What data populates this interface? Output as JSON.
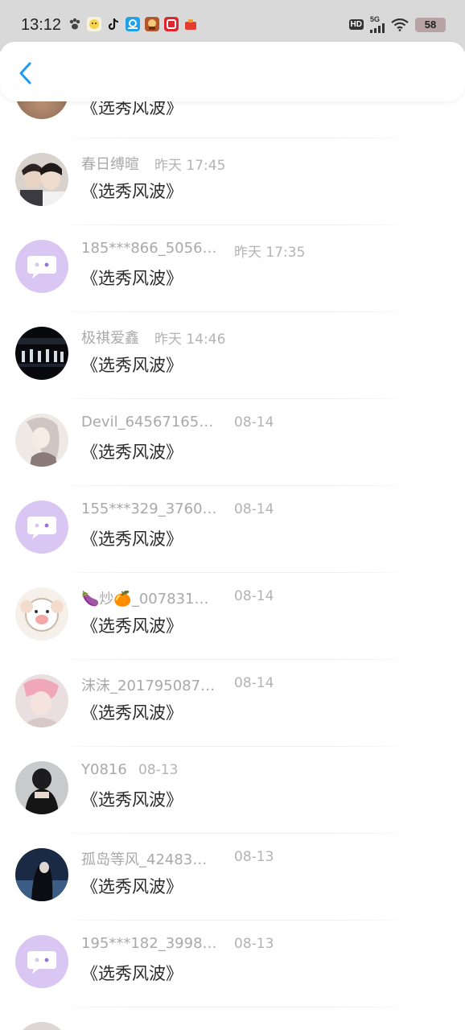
{
  "status_bar": {
    "time": "13:12",
    "network": "5G",
    "hd": "HD",
    "battery": "58",
    "app_icons": [
      "paw-icon",
      "emoji-icon",
      "tiktok-icon",
      "app-blue-icon",
      "game-icon",
      "red-app-icon",
      "red-box-icon"
    ]
  },
  "header": {
    "back_icon": "chevron-left-icon",
    "accent_color": "#1e9bf0"
  },
  "messages": [
    {
      "name": "",
      "time": "",
      "text": "《选秀风波》",
      "avatar": "photo-brown"
    },
    {
      "name": "春日缚暄",
      "time": "昨天 17:45",
      "text": "《选秀风波》",
      "avatar": "photo-boys"
    },
    {
      "name": "185***866_5056…",
      "time": "昨天 17:35",
      "text": "《选秀风波》",
      "avatar": "default"
    },
    {
      "name": "极祺爱鑫",
      "time": "昨天 14:46",
      "text": "《选秀风波》",
      "avatar": "photo-stage"
    },
    {
      "name": "Devil_64567165…",
      "time": "08-14",
      "text": "《选秀风波》",
      "avatar": "photo-anime"
    },
    {
      "name": "155***329_3760…",
      "time": "08-14",
      "text": "《选秀风波》",
      "avatar": "default"
    },
    {
      "name": "🍆炒🍊_007831…",
      "time": "08-14",
      "text": "《选秀风波》",
      "avatar": "photo-cartoon"
    },
    {
      "name": "沫沫_201795087…",
      "time": "08-14",
      "text": "《选秀风波》",
      "avatar": "photo-pink"
    },
    {
      "name": "Y0816",
      "time": "08-13",
      "text": "《选秀风波》",
      "avatar": "photo-dark"
    },
    {
      "name": "孤岛等风_42483…",
      "time": "08-13",
      "text": "《选秀风波》",
      "avatar": "photo-sea"
    },
    {
      "name": "195***182_3998…",
      "time": "08-13",
      "text": "《选秀风波》",
      "avatar": "default"
    }
  ]
}
